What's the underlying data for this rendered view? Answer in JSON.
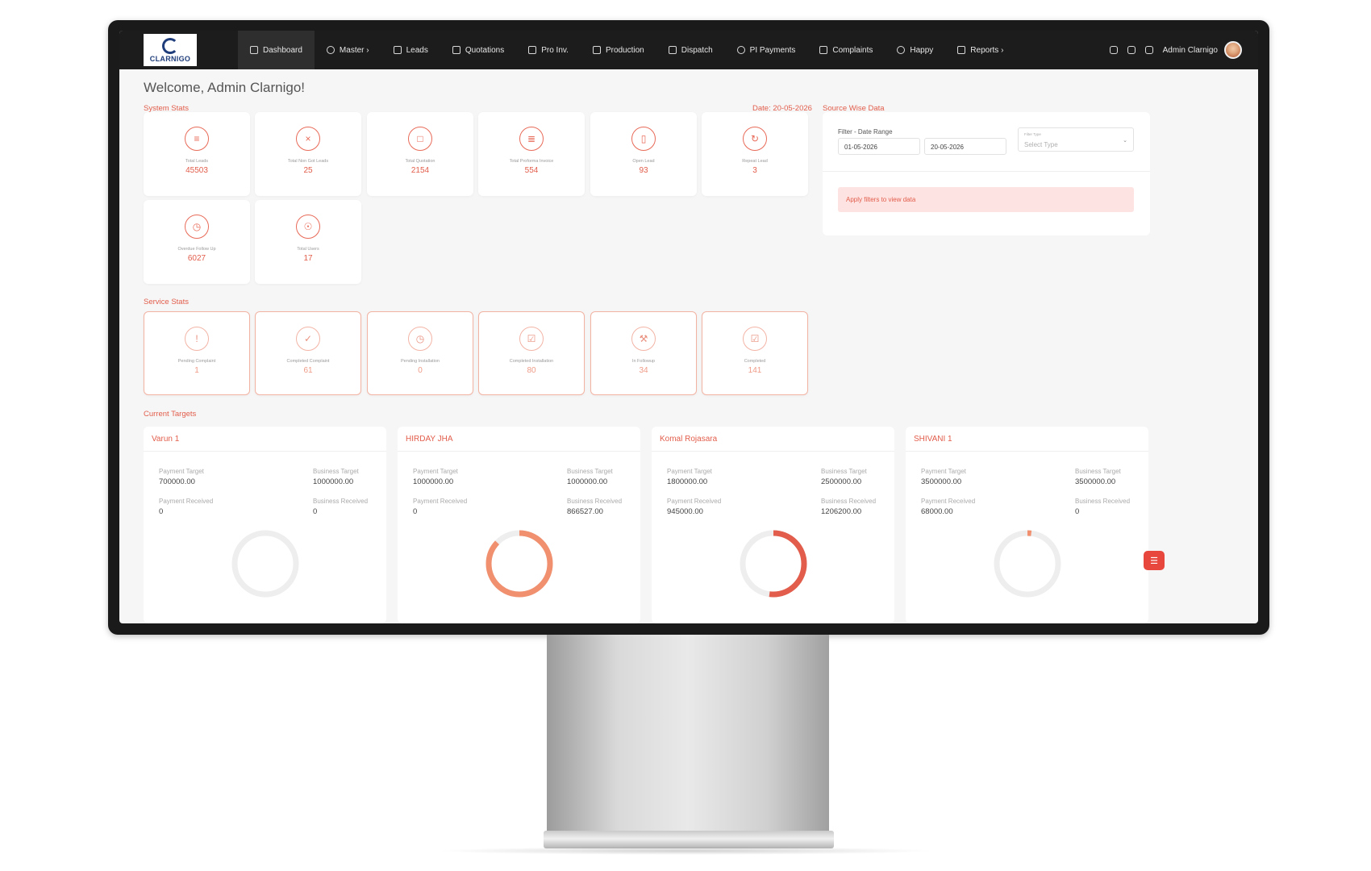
{
  "nav": {
    "logo_text": "CLARNIGO",
    "items": [
      {
        "label": "Dashboard"
      },
      {
        "label": "Master ›"
      },
      {
        "label": "Leads"
      },
      {
        "label": "Quotations"
      },
      {
        "label": "Pro Inv."
      },
      {
        "label": "Production"
      },
      {
        "label": "Dispatch"
      },
      {
        "label": "PI Payments"
      },
      {
        "label": "Complaints"
      },
      {
        "label": "Happy"
      },
      {
        "label": "Reports ›"
      }
    ],
    "user_name": "Admin Clarnigo"
  },
  "welcome": "Welcome, Admin Clarnigo!",
  "system_stats": {
    "title": "System Stats",
    "date": "Date: 20-05-2026",
    "cards": [
      {
        "label": "Total Leads",
        "value": "45503",
        "icon": "document-icon"
      },
      {
        "label": "Total Non Got Leads",
        "value": "25",
        "icon": "x-icon"
      },
      {
        "label": "Total Quotation",
        "value": "2154",
        "icon": "clipboard-icon"
      },
      {
        "label": "Total Proforma Invoice",
        "value": "554",
        "icon": "invoice-icon"
      },
      {
        "label": "Open Lead",
        "value": "93",
        "icon": "bookmark-icon"
      },
      {
        "label": "Repeat Lead",
        "value": "3",
        "icon": "repeat-icon"
      },
      {
        "label": "Overdue Follow Up",
        "value": "6027",
        "icon": "clock-icon"
      },
      {
        "label": "Total Users",
        "value": "17",
        "icon": "user-icon"
      }
    ]
  },
  "service_stats": {
    "title": "Service Stats",
    "cards": [
      {
        "label": "Pending Complaint",
        "value": "1",
        "icon": "alert-icon"
      },
      {
        "label": "Completed Complaint",
        "value": "61",
        "icon": "check-icon"
      },
      {
        "label": "Pending Installation",
        "value": "0",
        "icon": "clock-icon"
      },
      {
        "label": "Completed Installation",
        "value": "80",
        "icon": "edit-check-icon"
      },
      {
        "label": "In Followup",
        "value": "34",
        "icon": "wrench-icon"
      },
      {
        "label": "Completed",
        "value": "141",
        "icon": "checkbox-icon"
      }
    ]
  },
  "source": {
    "title": "Source Wise Data",
    "filter_label": "Filter - Date Range",
    "date_from": "01-05-2026",
    "date_to": "20-05-2026",
    "filter_type_label": "Filter Type",
    "filter_type_value": "Select Type",
    "apply_msg": "Apply filters to view data"
  },
  "targets": {
    "title": "Current Targets",
    "labels": {
      "payment_target": "Payment Target",
      "business_target": "Business Target",
      "payment_received": "Payment Received",
      "business_received": "Business Received"
    },
    "cards": [
      {
        "name": "Varun 1",
        "payment_target": "700000.00",
        "business_target": "1000000.00",
        "payment_received": "0",
        "business_received": "0",
        "progress": 0
      },
      {
        "name": "HIRDAY JHA",
        "payment_target": "1000000.00",
        "business_target": "1000000.00",
        "payment_received": "0",
        "business_received": "866527.00",
        "progress": 0.87
      },
      {
        "name": "Komal Rojasara",
        "payment_target": "1800000.00",
        "business_target": "2500000.00",
        "payment_received": "945000.00",
        "business_received": "1206200.00",
        "progress": 0.52
      },
      {
        "name": "SHIVANI 1",
        "payment_target": "3500000.00",
        "business_target": "3500000.00",
        "payment_received": "68000.00",
        "business_received": "0",
        "progress": 0.02
      }
    ]
  },
  "colors": {
    "accent": "#e25d4b",
    "navbar": "#1c1c1c",
    "donut_track": "#eeeeee",
    "donut_fill": "#f0906f"
  }
}
